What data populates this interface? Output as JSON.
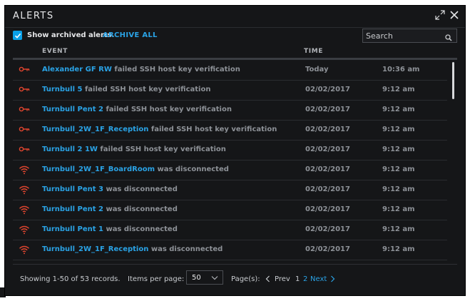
{
  "window": {
    "title": "ALERTS"
  },
  "toolbar": {
    "show_archived_label": "Show archived alerts.",
    "show_archived_checked": true,
    "archive_all_label": "ARCHIVE ALL",
    "search_placeholder": "Search"
  },
  "table": {
    "columns": {
      "event": "EVENT",
      "time": "TIME"
    },
    "rows": [
      {
        "icon": "key-icon",
        "device": "Alexander GF RW",
        "message": " failed SSH host key verification",
        "date": "Today",
        "time": "10:36 am"
      },
      {
        "icon": "key-icon",
        "device": "Turnbull 5",
        "message": " failed SSH host key verification",
        "date": "02/02/2017",
        "time": "9:12 am"
      },
      {
        "icon": "key-icon",
        "device": "Turnbull Pent 2",
        "message": " failed SSH host key verification",
        "date": "02/02/2017",
        "time": "9:12 am"
      },
      {
        "icon": "key-icon",
        "device": "Turnbull_2W_1F_Reception",
        "message": " failed SSH host key verification",
        "date": "02/02/2017",
        "time": "9:12 am"
      },
      {
        "icon": "key-icon",
        "device": "Turnbull 2 1W",
        "message": " failed SSH host key verification",
        "date": "02/02/2017",
        "time": "9:12 am"
      },
      {
        "icon": "wifi-icon",
        "device": "Turnbull_2W_1F_BoardRoom",
        "message": " was disconnected",
        "date": "02/02/2017",
        "time": "9:12 am"
      },
      {
        "icon": "wifi-icon",
        "device": "Turnbull Pent 3",
        "message": " was disconnected",
        "date": "02/02/2017",
        "time": "9:12 am"
      },
      {
        "icon": "wifi-icon",
        "device": "Turnbull Pent 2",
        "message": " was disconnected",
        "date": "02/02/2017",
        "time": "9:12 am"
      },
      {
        "icon": "wifi-icon",
        "device": "Turnbull Pent 1",
        "message": " was disconnected",
        "date": "02/02/2017",
        "time": "9:12 am"
      },
      {
        "icon": "wifi-icon",
        "device": "Turnbull_2W_1F_Reception",
        "message": " was disconnected",
        "date": "02/02/2017",
        "time": "9:12 am"
      }
    ]
  },
  "footer": {
    "showing": "Showing 1-50 of 53 records.",
    "items_per_page_label": "Items per page:",
    "items_per_page_value": "50",
    "pages_label": "Page(s):",
    "prev_label": "Prev",
    "page_1": "1",
    "page_2": "2",
    "next_label": "Next"
  },
  "colors": {
    "accent": "#2aa3e6",
    "alert_icon": "#e0452e",
    "background": "#151618"
  }
}
